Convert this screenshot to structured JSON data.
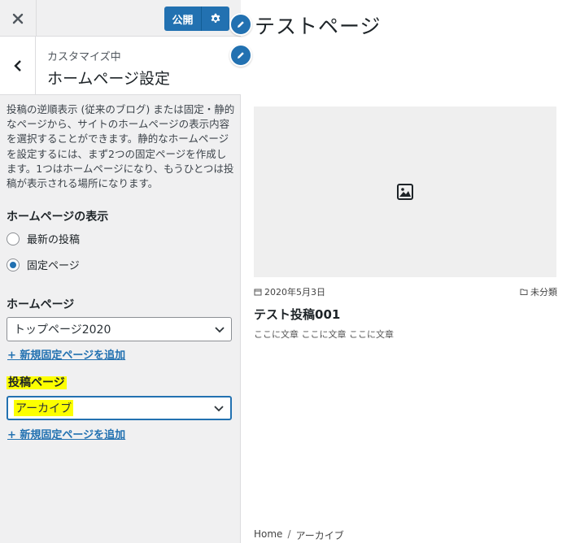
{
  "topbar": {
    "close_icon": "close-icon",
    "publish_label": "公開",
    "settings_icon": "gear-icon"
  },
  "section": {
    "customizing_label": "カスタマイズ中",
    "title": "ホームページ設定",
    "back_icon": "chevron-left-icon"
  },
  "description": "投稿の逆順表示 (従来のブログ) または固定・静的なページから、サイトのホームページの表示内容を選択することができます。静的なホームページを設定するには、まず2つの固定ページを作成します。1つはホームページになり、もうひとつは投稿が表示される場所になります。",
  "homepage_display": {
    "title": "ホームページの表示",
    "options": [
      {
        "label": "最新の投稿",
        "checked": false
      },
      {
        "label": "固定ページ",
        "checked": true
      }
    ]
  },
  "homepage_select": {
    "title": "ホームページ",
    "value": "トップページ2020",
    "add_link": "+ 新規固定ページを追加"
  },
  "posts_page_select": {
    "title": "投稿ページ",
    "value": "アーカイブ",
    "add_link": "+ 新規固定ページを追加",
    "highlight_color": "#fcff00"
  },
  "preview": {
    "site_title": "テストページ",
    "post": {
      "date": "2020年5月3日",
      "category": "未分類",
      "title": "テスト投稿001",
      "excerpt": "ここに文章 ここに文章 ここに文章"
    },
    "breadcrumb": {
      "home": "Home",
      "separator": "/",
      "current": "アーカイブ"
    }
  },
  "colors": {
    "accent": "#2271b1",
    "sidebar_bg": "#f0f0f1"
  }
}
